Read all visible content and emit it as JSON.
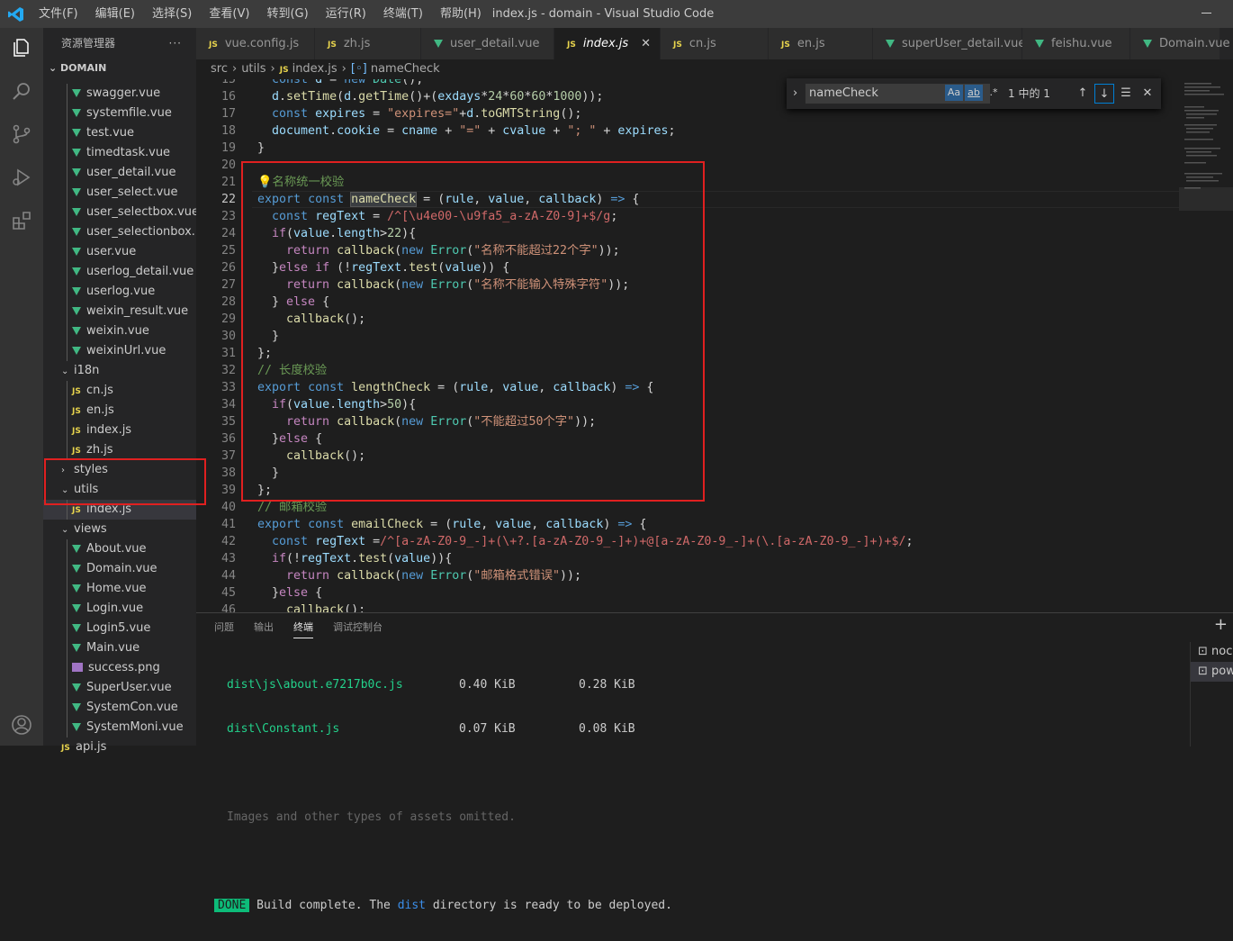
{
  "titlebar": {
    "menus": [
      "文件(F)",
      "编辑(E)",
      "选择(S)",
      "查看(V)",
      "转到(G)",
      "运行(R)",
      "终端(T)",
      "帮助(H)"
    ],
    "title": "index.js - domain - Visual Studio Code"
  },
  "sidebar": {
    "header": "资源管理器",
    "more": "···",
    "section": "DOMAIN",
    "items": [
      {
        "label": "swagger.vue",
        "type": "vue",
        "indent": 2
      },
      {
        "label": "systemfile.vue",
        "type": "vue",
        "indent": 2
      },
      {
        "label": "test.vue",
        "type": "vue",
        "indent": 2
      },
      {
        "label": "timedtask.vue",
        "type": "vue",
        "indent": 2
      },
      {
        "label": "user_detail.vue",
        "type": "vue",
        "indent": 2
      },
      {
        "label": "user_select.vue",
        "type": "vue",
        "indent": 2
      },
      {
        "label": "user_selectbox.vue",
        "type": "vue",
        "indent": 2
      },
      {
        "label": "user_selectionbox....",
        "type": "vue",
        "indent": 2
      },
      {
        "label": "user.vue",
        "type": "vue",
        "indent": 2
      },
      {
        "label": "userlog_detail.vue",
        "type": "vue",
        "indent": 2
      },
      {
        "label": "userlog.vue",
        "type": "vue",
        "indent": 2
      },
      {
        "label": "weixin_result.vue",
        "type": "vue",
        "indent": 2
      },
      {
        "label": "weixin.vue",
        "type": "vue",
        "indent": 2
      },
      {
        "label": "weixinUrl.vue",
        "type": "vue",
        "indent": 2
      },
      {
        "label": "i18n",
        "type": "folder-open",
        "indent": 1
      },
      {
        "label": "cn.js",
        "type": "js",
        "indent": 2
      },
      {
        "label": "en.js",
        "type": "js",
        "indent": 2
      },
      {
        "label": "index.js",
        "type": "js",
        "indent": 2
      },
      {
        "label": "zh.js",
        "type": "js",
        "indent": 2
      },
      {
        "label": "styles",
        "type": "folder",
        "indent": 1
      },
      {
        "label": "utils",
        "type": "folder-open",
        "indent": 1
      },
      {
        "label": "index.js",
        "type": "js",
        "indent": 2,
        "selected": true
      },
      {
        "label": "views",
        "type": "folder-open",
        "indent": 1
      },
      {
        "label": "About.vue",
        "type": "vue",
        "indent": 2
      },
      {
        "label": "Domain.vue",
        "type": "vue",
        "indent": 2
      },
      {
        "label": "Home.vue",
        "type": "vue",
        "indent": 2
      },
      {
        "label": "Login.vue",
        "type": "vue",
        "indent": 2
      },
      {
        "label": "Login5.vue",
        "type": "vue",
        "indent": 2
      },
      {
        "label": "Main.vue",
        "type": "vue",
        "indent": 2
      },
      {
        "label": "success.png",
        "type": "png",
        "indent": 2
      },
      {
        "label": "SuperUser.vue",
        "type": "vue",
        "indent": 2
      },
      {
        "label": "SystemCon.vue",
        "type": "vue",
        "indent": 2
      },
      {
        "label": "SystemMoni.vue",
        "type": "vue",
        "indent": 2
      },
      {
        "label": "api.js",
        "type": "js",
        "indent": 1
      }
    ]
  },
  "tabs": [
    {
      "label": "vue.config.js",
      "type": "js"
    },
    {
      "label": "zh.js",
      "type": "js"
    },
    {
      "label": "user_detail.vue",
      "type": "vue"
    },
    {
      "label": "index.js",
      "type": "js",
      "active": true,
      "close": "✕"
    },
    {
      "label": "cn.js",
      "type": "js"
    },
    {
      "label": "en.js",
      "type": "js"
    },
    {
      "label": "superUser_detail.vue",
      "type": "vue"
    },
    {
      "label": "feishu.vue",
      "type": "vue"
    },
    {
      "label": "Domain.vue",
      "type": "vue"
    }
  ],
  "breadcrumb": {
    "parts": [
      "src",
      "utils",
      "index.js",
      "nameCheck"
    ]
  },
  "find": {
    "value": "nameCheck",
    "match_case": "Aa",
    "whole_word": "ab",
    "regex": ".*",
    "count": "1 中的 1"
  },
  "editor": {
    "lines": [
      {
        "n": "15",
        "html": "  <span class='k'>const</span> <span class='v'>d</span> = <span class='k'>new</span> <span class='t'>Date</span>();"
      },
      {
        "n": "16",
        "html": "  <span class='v'>d</span>.<span class='f'>setTime</span>(<span class='v'>d</span>.<span class='f'>getTime</span>()+(<span class='v'>exdays</span>*<span class='n'>24</span>*<span class='n'>60</span>*<span class='n'>60</span>*<span class='n'>1000</span>));"
      },
      {
        "n": "17",
        "html": "  <span class='k'>const</span> <span class='v'>expires</span> = <span class='s'>\"expires=\"</span>+<span class='v'>d</span>.<span class='f'>toGMTString</span>();"
      },
      {
        "n": "18",
        "html": "  <span class='v'>document</span>.<span class='v'>cookie</span> = <span class='v'>cname</span> + <span class='s'>\"=\"</span> + <span class='v'>cvalue</span> + <span class='s'>\"; \"</span> + <span class='v'>expires</span>;"
      },
      {
        "n": "19",
        "html": "}"
      },
      {
        "n": "20",
        "html": ""
      },
      {
        "n": "21",
        "html": "<span class='c'>💡名称统一校验</span>"
      },
      {
        "n": "22",
        "html": "<span class='k'>export</span> <span class='k'>const</span> <span class='f hl'>nameCheck</span> = (<span class='v'>rule</span>, <span class='v'>value</span>, <span class='v'>callback</span>) <span class='k'>=&gt;</span> {",
        "cur": true
      },
      {
        "n": "23",
        "html": "  <span class='k'>const</span> <span class='v'>regText</span> = <span class='r'>/^[\\u4e00-\\u9fa5_a-zA-Z0-9]+$/g</span>;"
      },
      {
        "n": "24",
        "html": "  <span class='p'>if</span>(<span class='v'>value</span>.<span class='v'>length</span>&gt;<span class='n'>22</span>){"
      },
      {
        "n": "25",
        "html": "    <span class='p'>return</span> <span class='f'>callback</span>(<span class='k'>new</span> <span class='t'>Error</span>(<span class='s'>\"名称不能超过22个字\"</span>));"
      },
      {
        "n": "26",
        "html": "  }<span class='p'>else</span> <span class='p'>if</span> (!<span class='v'>regText</span>.<span class='f'>test</span>(<span class='v'>value</span>)) {"
      },
      {
        "n": "27",
        "html": "    <span class='p'>return</span> <span class='f'>callback</span>(<span class='k'>new</span> <span class='t'>Error</span>(<span class='s'>\"名称不能输入特殊字符\"</span>));"
      },
      {
        "n": "28",
        "html": "  } <span class='p'>else</span> {"
      },
      {
        "n": "29",
        "html": "    <span class='f'>callback</span>();"
      },
      {
        "n": "30",
        "html": "  }"
      },
      {
        "n": "31",
        "html": "};"
      },
      {
        "n": "32",
        "html": "<span class='c'>// 长度校验</span>"
      },
      {
        "n": "33",
        "html": "<span class='k'>export</span> <span class='k'>const</span> <span class='f'>lengthCheck</span> = (<span class='v'>rule</span>, <span class='v'>value</span>, <span class='v'>callback</span>) <span class='k'>=&gt;</span> {"
      },
      {
        "n": "34",
        "html": "  <span class='p'>if</span>(<span class='v'>value</span>.<span class='v'>length</span>&gt;<span class='n'>50</span>){"
      },
      {
        "n": "35",
        "html": "    <span class='p'>return</span> <span class='f'>callback</span>(<span class='k'>new</span> <span class='t'>Error</span>(<span class='s'>\"不能超过50个字\"</span>));"
      },
      {
        "n": "36",
        "html": "  }<span class='p'>else</span> {"
      },
      {
        "n": "37",
        "html": "    <span class='f'>callback</span>();"
      },
      {
        "n": "38",
        "html": "  }"
      },
      {
        "n": "39",
        "html": "};"
      },
      {
        "n": "40",
        "html": "<span class='c'>// 邮箱校验</span>"
      },
      {
        "n": "41",
        "html": "<span class='k'>export</span> <span class='k'>const</span> <span class='f'>emailCheck</span> = (<span class='v'>rule</span>, <span class='v'>value</span>, <span class='v'>callback</span>) <span class='k'>=&gt;</span> {"
      },
      {
        "n": "42",
        "html": "  <span class='k'>const</span> <span class='v'>regText</span> =<span class='r'>/^[a-zA-Z0-9_-]+(\\+?.[a-zA-Z0-9_-]+)+@[a-zA-Z0-9_-]+(\\.[a-zA-Z0-9_-]+)+$/</span>;"
      },
      {
        "n": "43",
        "html": "  <span class='p'>if</span>(!<span class='v'>regText</span>.<span class='f'>test</span>(<span class='v'>value</span>)){"
      },
      {
        "n": "44",
        "html": "    <span class='p'>return</span> <span class='f'>callback</span>(<span class='k'>new</span> <span class='t'>Error</span>(<span class='s'>\"邮箱格式错误\"</span>));"
      },
      {
        "n": "45",
        "html": "  }<span class='p'>else</span> {"
      },
      {
        "n": "46",
        "html": "    <span class='f'>callback</span>();"
      }
    ]
  },
  "panel": {
    "tabs": [
      "问题",
      "输出",
      "终端",
      "调试控制台"
    ],
    "active": "终端",
    "plus": "+",
    "rows": [
      {
        "file": "dist\\js\\about.e7217b0c.js",
        "size": "0.40 KiB",
        "gz": "0.28 KiB"
      },
      {
        "file": "dist\\Constant.js",
        "size": "0.07 KiB",
        "gz": "0.08 KiB"
      }
    ],
    "note": "Images and other types of assets omitted.",
    "done": "DONE",
    "build_a": "Build complete. The ",
    "build_b": "dist",
    "build_c": " directory is ready to be deployed.",
    "terminals": [
      "noc",
      "pow"
    ]
  }
}
